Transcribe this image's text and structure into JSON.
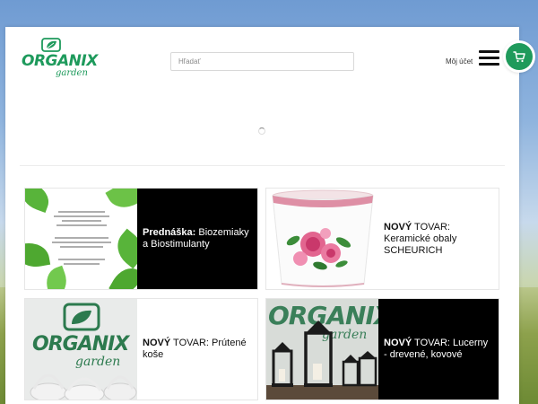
{
  "brand": {
    "name": "ORGANIX",
    "tagline": "garden",
    "color": "#1e9a5c"
  },
  "header": {
    "search_placeholder": "Hľadať",
    "account_label": "Môj účet",
    "menu_icon": "hamburger-icon",
    "cart_icon": "cart-icon",
    "cart_color": "#1f9a5b"
  },
  "cards": [
    {
      "bold": "Prednáška:",
      "text": " Biozemiaky a Biostimulanty",
      "theme": "dark"
    },
    {
      "bold": "NOVÝ",
      "text": " TOVAR: Keramické obaly SCHEURICH",
      "theme": "light"
    },
    {
      "bold": "NOVÝ",
      "text": " TOVAR: Prútené koše",
      "theme": "light"
    },
    {
      "bold": "NOVÝ",
      "text": " TOVAR: Lucerny - drevené, kovové",
      "theme": "dark"
    }
  ],
  "thumbs": {
    "c3_logo_word": "ORGANIX",
    "c3_logo_sub": "garden",
    "c4_logo_word": "ORGANIX",
    "c4_logo_sub": "garden"
  }
}
